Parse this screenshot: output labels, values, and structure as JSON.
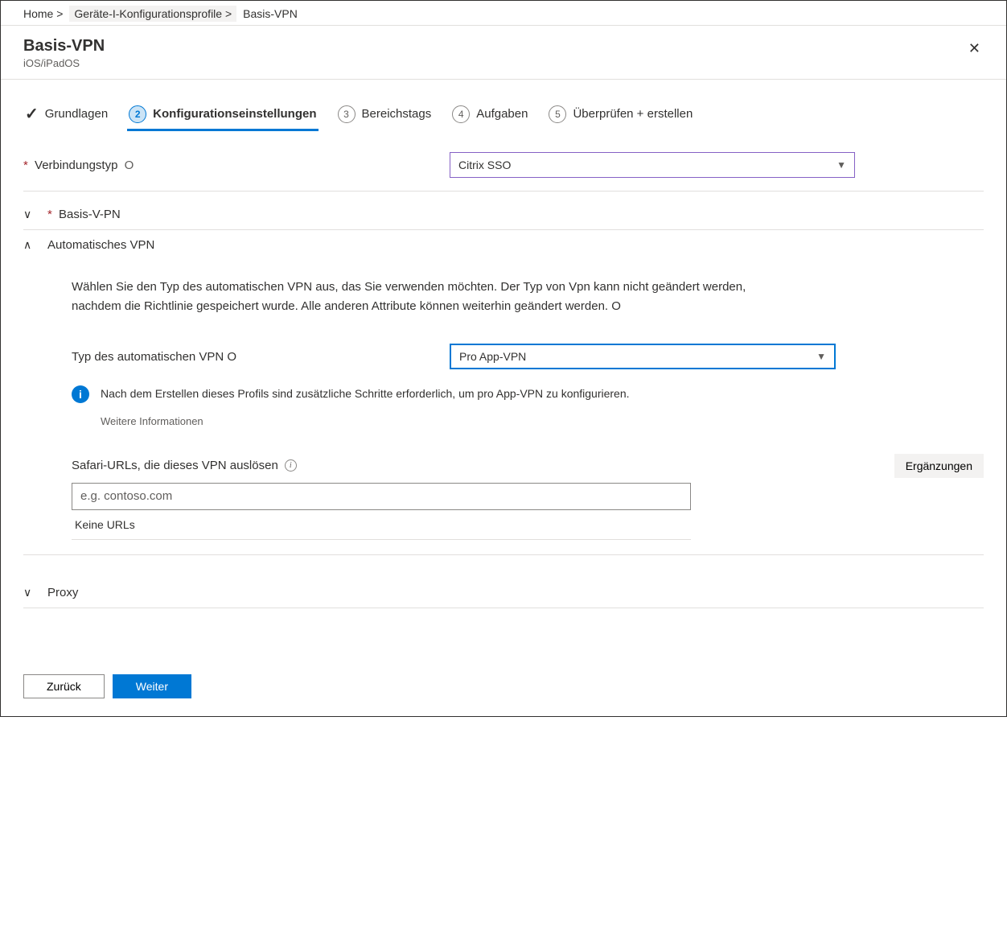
{
  "breadcrumb": {
    "home": "Home >",
    "devices": "Geräte-I-Konfigurationsprofile >",
    "current": "Basis-VPN"
  },
  "panel": {
    "title": "Basis-VPN",
    "subtitle": "iOS/iPadOS"
  },
  "steps": {
    "s1": "Grundlagen",
    "s2": "Konfigurationseinstellungen",
    "s2_num": "2",
    "s3": "Bereichstags",
    "s3_num": "3",
    "s4": "Aufgaben",
    "s4_num": "4",
    "s5": "Überprüfen + erstellen",
    "s5_num": "5"
  },
  "connection": {
    "label": "Verbindungstyp",
    "info": "O",
    "value": "Citrix SSO"
  },
  "sections": {
    "basis": "Basis-V-PN",
    "auto": "Automatisches VPN",
    "proxy": "Proxy"
  },
  "auto": {
    "description": "Wählen Sie den Typ des automatischen VPN aus, das Sie verwenden möchten. Der Typ von Vpn kann nicht geändert werden, nachdem die Richtlinie gespeichert wurde. Alle anderen Attribute können weiterhin geändert werden. O",
    "type_label": "Typ des automatischen VPN O",
    "type_value": "Pro App-VPN",
    "info_text": "Nach dem Erstellen dieses Profils sind zusätzliche Schritte erforderlich, um pro App-VPN zu konfigurieren.",
    "learn_more": "Weitere Informationen",
    "safari_label": "Safari-URLs, die dieses VPN auslösen",
    "add_label": "Ergänzungen",
    "url_placeholder": "e.g. contoso.com",
    "no_urls": "Keine URLs"
  },
  "footer": {
    "back": "Zurück",
    "next": "Weiter"
  }
}
